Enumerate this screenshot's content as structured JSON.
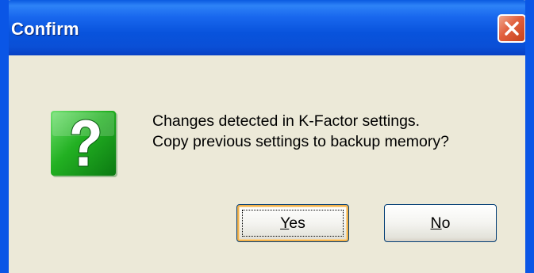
{
  "window": {
    "title": "Confirm"
  },
  "dialog": {
    "icon": "question-icon",
    "message_line1": "Changes detected in K-Factor settings.",
    "message_line2": "Copy previous settings to backup memory?"
  },
  "buttons": {
    "yes_accel": "Y",
    "yes_rest": "es",
    "no_accel": "N",
    "no_rest": "o"
  },
  "colors": {
    "titlebar": "#0a56e6",
    "dialog_background": "#ece9d8",
    "icon_green": "#22b022",
    "close_red": "#e15f3d"
  }
}
